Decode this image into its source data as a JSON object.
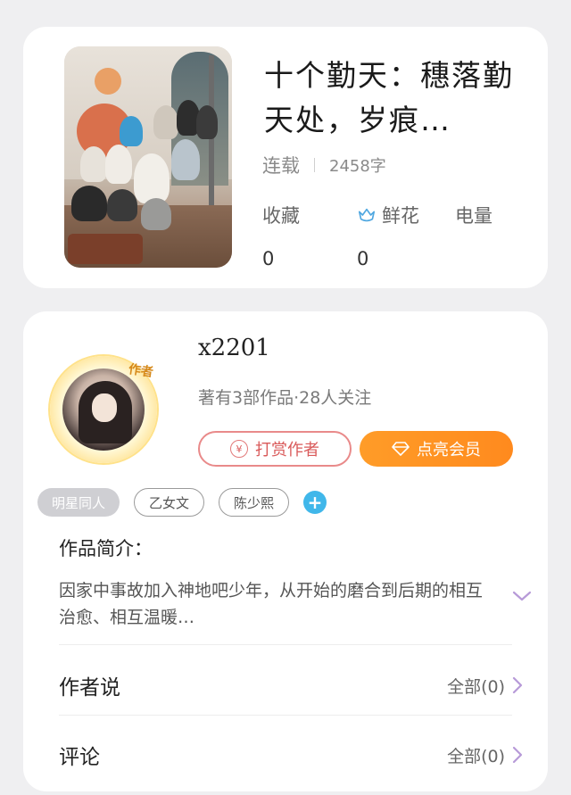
{
  "book": {
    "title": "十个勤天：穗落勤天处，岁痕…",
    "status": "连载",
    "word_count": "2458字",
    "stats": [
      {
        "label": "收藏",
        "value": "0"
      },
      {
        "label": "鲜花",
        "value": "0",
        "icon": "flower-icon"
      },
      {
        "label": "电量",
        "value": ""
      }
    ]
  },
  "author": {
    "name": "x2201",
    "badge": "作者",
    "info": "著有3部作品·28人关注",
    "reward_label": "打赏作者",
    "vip_label": "点亮会员"
  },
  "tags": [
    "明星同人",
    "乙女文",
    "陈少熙"
  ],
  "intro": {
    "title": "作品简介：",
    "text": "因家中事故加入神地吧少年，从开始的磨合到后期的相互治愈、相互温暖…"
  },
  "author_says": {
    "label": "作者说",
    "action": "全部(0)"
  },
  "comments": {
    "label": "评论",
    "action": "全部(0)"
  },
  "colors": {
    "accent_orange": "#ff9320",
    "reward_red": "#e27a7a",
    "chevron_purple": "#b79ad8",
    "tag_blue": "#40b7ea"
  }
}
